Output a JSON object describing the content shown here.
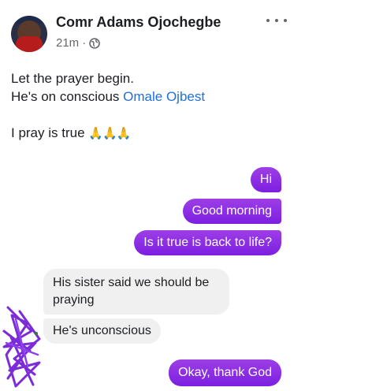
{
  "post": {
    "author": "Comr Adams Ojochegbe",
    "time": "21m",
    "separator": "·",
    "privacy_icon": "globe-icon",
    "more_icon": "more-options-icon",
    "line1": "Let the prayer begin.",
    "line2_prefix": "He's on conscious ",
    "line2_link": "Omale Ojbest",
    "line3_text": "I pray is true ",
    "line3_emoji": "🙏🙏🙏",
    "link_color": "#216fdb"
  },
  "chat": {
    "messages": [
      {
        "from": "me",
        "text": "Hi"
      },
      {
        "from": "me",
        "text": "Good morning"
      },
      {
        "from": "me",
        "text": "Is it true is back to life?"
      },
      {
        "from": "them",
        "text": "His sister said we should be praying"
      },
      {
        "from": "them",
        "text": "He's unconscious"
      },
      {
        "from": "me",
        "text": "Okay, thank God"
      }
    ],
    "outgoing_color": "#8a2be2",
    "incoming_color": "#f0f0f0"
  }
}
